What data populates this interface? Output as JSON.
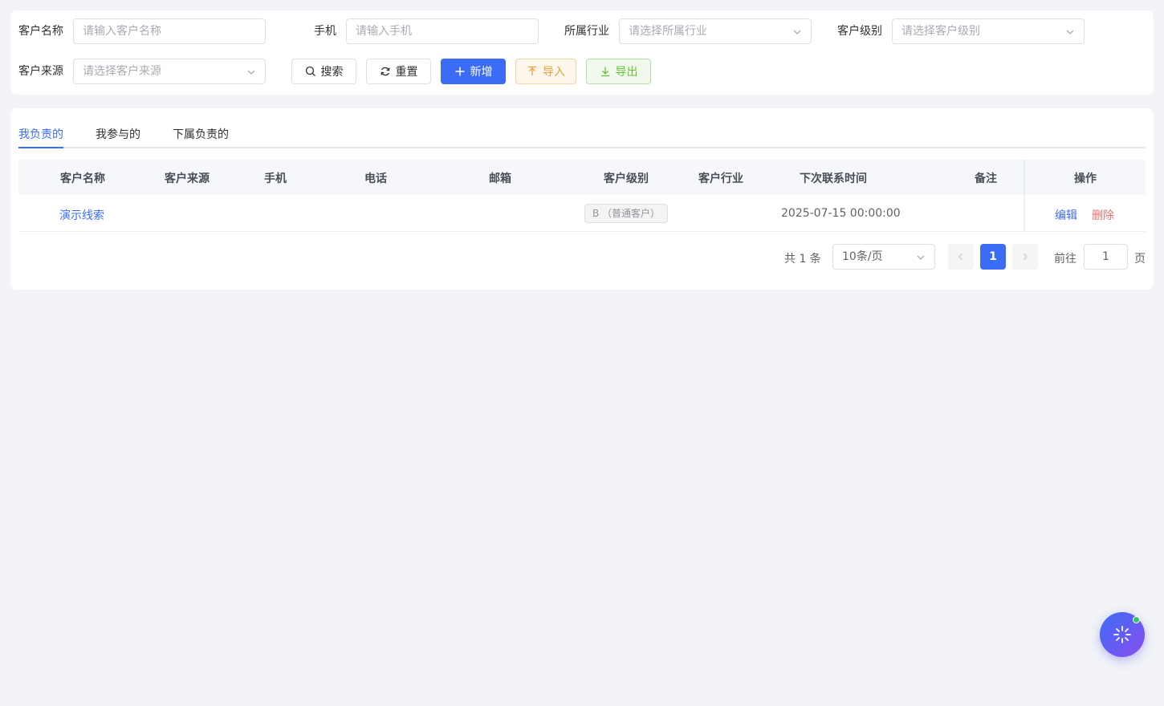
{
  "search": {
    "customer_name": {
      "label": "客户名称",
      "placeholder": "请输入客户名称"
    },
    "mobile": {
      "label": "手机",
      "placeholder": "请输入手机"
    },
    "industry": {
      "label": "所属行业",
      "placeholder": "请选择所属行业"
    },
    "level": {
      "label": "客户级别",
      "placeholder": "请选择客户级别"
    },
    "source": {
      "label": "客户来源",
      "placeholder": "请选择客户来源"
    }
  },
  "actions": {
    "search": "搜索",
    "reset": "重置",
    "add": "新增",
    "import": "导入",
    "export": "导出"
  },
  "tabs": [
    "我负责的",
    "我参与的",
    "下属负责的"
  ],
  "active_tab": "我负责的",
  "table": {
    "columns": [
      "客户名称",
      "客户来源",
      "手机",
      "电话",
      "邮箱",
      "客户级别",
      "客户行业",
      "下次联系时间",
      "备注",
      "操作"
    ],
    "rows": [
      {
        "name": "演示线索",
        "source": "",
        "mobile": "",
        "phone": "",
        "email": "",
        "level": "B （普通客户）",
        "industry": "",
        "next_contact": "2025-07-15 00:00:00",
        "remark": "",
        "edit": "编辑",
        "delete": "删除"
      }
    ]
  },
  "pagination": {
    "total_text": "共 1 条",
    "page_size": "10条/页",
    "current_page": "1",
    "goto_label": "前往",
    "goto_value": "1",
    "page_suffix": "页"
  },
  "colors": {
    "primary": "#3b6cf6",
    "danger": "#f56c6c",
    "warning": "#e6a23c",
    "success": "#67c23a"
  },
  "icons": {
    "search": "search-icon",
    "reset": "refresh-icon",
    "add": "plus-icon",
    "import": "upload-icon",
    "export": "download-icon",
    "assistant": "sparkle-icon"
  }
}
